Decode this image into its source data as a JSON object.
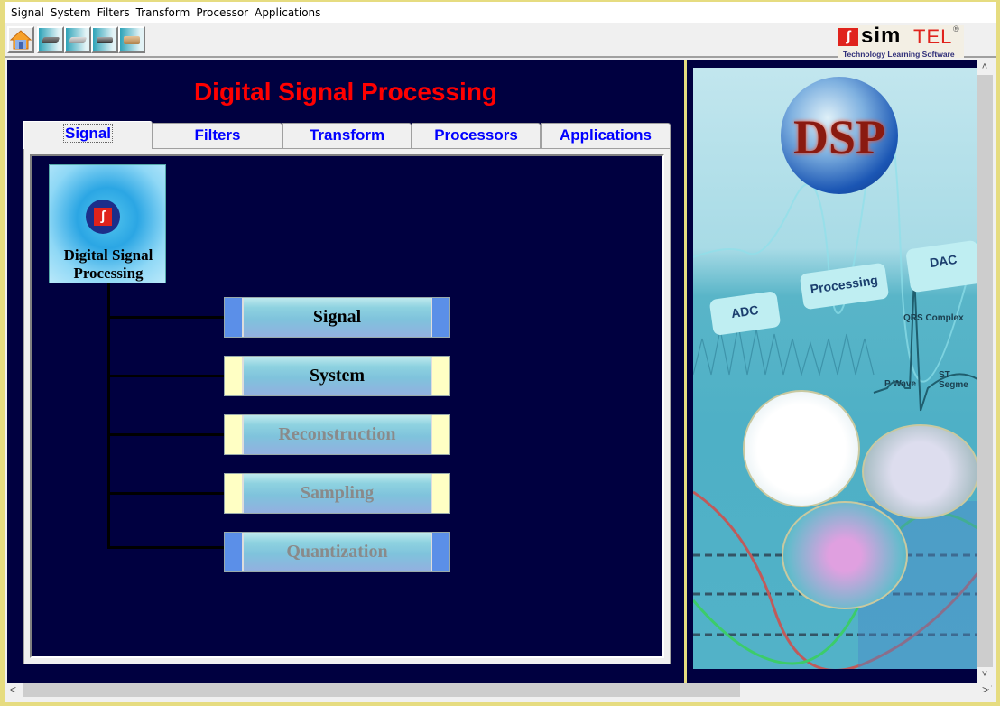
{
  "menubar": {
    "items": [
      "Signal",
      "System",
      "Filters",
      "Transform",
      "Processor",
      "Applications"
    ]
  },
  "toolbar": {
    "buttons": [
      {
        "icon": "home-icon"
      },
      {
        "icon": "device-icon"
      },
      {
        "icon": "device-icon"
      },
      {
        "icon": "device-icon"
      },
      {
        "icon": "device-icon"
      }
    ],
    "logo": {
      "mark": "ʃ",
      "brand_bold": "sim",
      "brand_light": "TEL",
      "registered": "®",
      "tagline": "Technology Learning Software"
    }
  },
  "main": {
    "title": "Digital Signal Processing",
    "tabs": [
      {
        "label": "Signal",
        "active": true
      },
      {
        "label": "Filters",
        "active": false
      },
      {
        "label": "Transform",
        "active": false
      },
      {
        "label": "Processors",
        "active": false
      },
      {
        "label": "Applications",
        "active": false
      }
    ],
    "root_card": {
      "label_line1": "Digital Signal",
      "label_line2": "Processing",
      "mark": "ʃ"
    },
    "nodes": [
      {
        "label": "Signal",
        "style": "blue",
        "enabled": true
      },
      {
        "label": "System",
        "style": "yellow",
        "enabled": true
      },
      {
        "label": "Reconstruction",
        "style": "yellow",
        "enabled": false
      },
      {
        "label": "Sampling",
        "style": "yellow",
        "enabled": false
      },
      {
        "label": "Quantization",
        "style": "blue",
        "enabled": false
      }
    ]
  },
  "side_image": {
    "globe_text": "DSP",
    "flow": [
      "ADC",
      "Processing",
      "DAC"
    ],
    "ecg_labels": [
      "QRS Complex",
      "ST Segme",
      "P Wave"
    ]
  },
  "scrollbars": {
    "up": "˄",
    "down": "˅",
    "left": "<",
    "right": ">"
  }
}
